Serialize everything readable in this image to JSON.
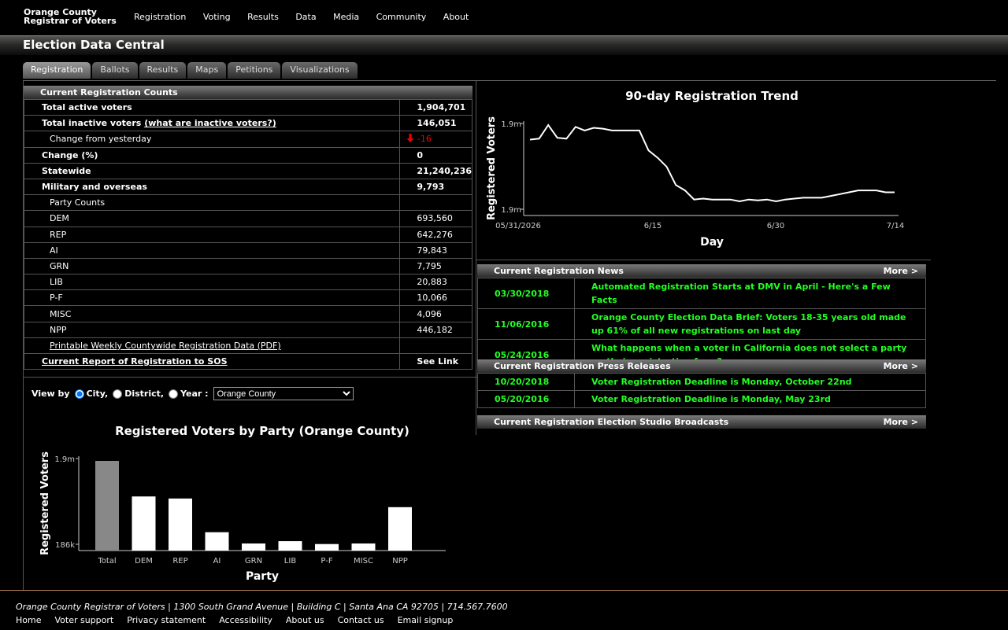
{
  "header": {
    "logo_line1": "Orange County",
    "logo_line2": "Registrar of Voters",
    "nav": [
      "Registration",
      "Voting",
      "Results",
      "Data",
      "Media",
      "Community",
      "About"
    ]
  },
  "page_title": "Election Data Central",
  "tabs": [
    "Registration",
    "Ballots",
    "Results",
    "Maps",
    "Petitions",
    "Visualizations"
  ],
  "counts": {
    "heading": "Current Registration Counts",
    "total_active_label": "Total active voters",
    "total_active_value": "1,904,701",
    "inactive_label": "Total inactive voters",
    "inactive_link": "(what are inactive voters?)",
    "inactive_value": "146,051",
    "change_yesterday_label": "Change from yesterday",
    "change_yesterday_value": "-16",
    "change_pct_label": "Change (%)",
    "change_pct_value": "0",
    "statewide_label": "Statewide",
    "statewide_value": "21,240,236",
    "military_label": "Military and overseas",
    "military_value": "9,793",
    "party_counts_label": "Party Counts",
    "parties": [
      {
        "name": "DEM",
        "value": "693,560"
      },
      {
        "name": "REP",
        "value": "642,276"
      },
      {
        "name": "AI",
        "value": "79,843"
      },
      {
        "name": "GRN",
        "value": "7,795"
      },
      {
        "name": "LIB",
        "value": "20,883"
      },
      {
        "name": "P-F",
        "value": "10,066"
      },
      {
        "name": "MISC",
        "value": "4,096"
      },
      {
        "name": "NPP",
        "value": "446,182"
      }
    ],
    "printable_link": "Printable Weekly Countywide Registration Data (PDF)",
    "sos_link": "Current Report of Registration to SOS",
    "sos_value": "See Link"
  },
  "view_by": {
    "label": "View by",
    "options": [
      "City,",
      "District,",
      "Year :"
    ],
    "selected_value": "Orange County"
  },
  "bar_chart": {
    "title": "Registered Voters by Party (Orange County)",
    "xlabel": "Party",
    "ylabel": "Registered Voters",
    "ytick_top": "1.9m",
    "ytick_bottom": "186k"
  },
  "trend_chart": {
    "title": "90-day Registration Trend",
    "xlabel": "Day",
    "ylabel": "Registered Voters",
    "ytick_top": "1.9m",
    "ytick_bottom": "1.9m",
    "xticks": [
      "05/31/2026",
      "6/15",
      "6/30",
      "7/14"
    ]
  },
  "chart_data": [
    {
      "type": "bar",
      "title": "Registered Voters by Party (Orange County)",
      "xlabel": "Party",
      "ylabel": "Registered Voters",
      "categories": [
        "Total",
        "DEM",
        "REP",
        "AI",
        "GRN",
        "LIB",
        "P-F",
        "MISC",
        "NPP"
      ],
      "values": [
        1904701,
        693560,
        642276,
        79843,
        7795,
        20883,
        10066,
        4096,
        446182
      ],
      "yticks": [
        "186k",
        "1.9m"
      ],
      "highlight_color": "#888888",
      "bar_color": "#ffffff"
    },
    {
      "type": "line",
      "title": "90-day Registration Trend",
      "xlabel": "Day",
      "ylabel": "Registered Voters",
      "xticks": [
        "05/31/2026",
        "6/15",
        "6/30",
        "7/14"
      ],
      "x": [
        "2026-06-04",
        "2026-06-05",
        "2026-06-06",
        "2026-06-07",
        "2026-06-08",
        "2026-06-09",
        "2026-06-10",
        "2026-06-11",
        "2026-06-12",
        "2026-06-13",
        "2026-06-14",
        "2026-06-15",
        "2026-06-16",
        "2026-06-17",
        "2026-06-18",
        "2026-06-19",
        "2026-06-20",
        "2026-06-21",
        "2026-06-22",
        "2026-06-23",
        "2026-06-24",
        "2026-06-25",
        "2026-06-26",
        "2026-06-27",
        "2026-06-28",
        "2026-06-29",
        "2026-06-30",
        "2026-07-01",
        "2026-07-02",
        "2026-07-03",
        "2026-07-04",
        "2026-07-05",
        "2026-07-06",
        "2026-07-07",
        "2026-07-08",
        "2026-07-09",
        "2026-07-10",
        "2026-07-11",
        "2026-07-12",
        "2026-07-13",
        "2026-07-14"
      ],
      "values": [
        1906800,
        1906850,
        1907600,
        1906900,
        1906850,
        1907500,
        1907300,
        1907450,
        1907400,
        1907300,
        1907300,
        1907300,
        1907300,
        1906200,
        1905800,
        1905300,
        1904300,
        1904000,
        1903500,
        1903550,
        1903500,
        1903500,
        1903500,
        1903400,
        1903500,
        1903450,
        1903500,
        1903400,
        1903500,
        1903550,
        1903600,
        1903600,
        1903600,
        1903700,
        1903800,
        1903900,
        1904000,
        1904000,
        1904000,
        1903900,
        1903900
      ],
      "yticks": [
        "1.9m",
        "1.9m"
      ]
    }
  ],
  "news_sections": {
    "reg_news": {
      "heading": "Current Registration News",
      "more": "More >",
      "items": [
        {
          "date": "03/30/2018",
          "headline": "Automated Registration Starts at DMV in April - Here's a Few Facts"
        },
        {
          "date": "11/06/2016",
          "headline": "Orange County Election Data Brief: Voters 18-35 years old made up 61% of all new registrations on last day"
        },
        {
          "date": "05/24/2016",
          "headline": "What happens when a voter in California does not select a party on their registration form?"
        }
      ]
    },
    "press": {
      "heading": "Current Registration Press Releases",
      "more": "More >",
      "items": [
        {
          "date": "10/20/2018",
          "headline": "Voter Registration Deadline is Monday, October 22nd"
        },
        {
          "date": "05/20/2016",
          "headline": "Voter Registration Deadline is Monday, May 23rd"
        }
      ]
    },
    "studio": {
      "heading": "Current Registration Election Studio Broadcasts",
      "more": "More >"
    }
  },
  "footer": {
    "address": "Orange County Registrar of Voters | 1300 South Grand Avenue | Building C | Santa Ana CA 92705 | 714.567.7600",
    "links": [
      "Home",
      "Voter support",
      "Privacy statement",
      "Accessibility",
      "About us",
      "Contact us",
      "Email signup"
    ]
  }
}
